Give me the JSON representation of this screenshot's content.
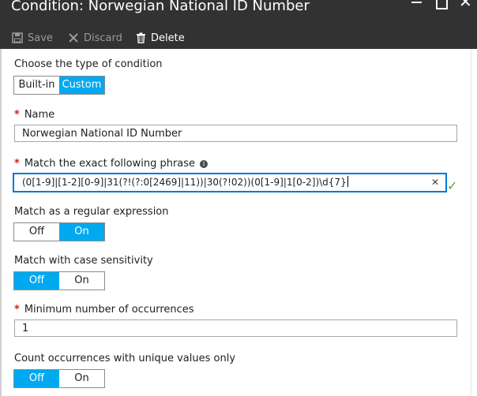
{
  "window": {
    "title": "Condition: Norwegian National ID Number",
    "minimize_glyph": "",
    "maximize_glyph": "",
    "close_glyph": "✕"
  },
  "toolbar": {
    "save_label": "Save",
    "discard_label": "Discard",
    "delete_label": "Delete"
  },
  "condition_type": {
    "label": "Choose the type of condition",
    "options": [
      "Built-in",
      "Custom"
    ],
    "selected": "Custom"
  },
  "name": {
    "required_marker": "*",
    "label": "Name",
    "value": "Norwegian National ID Number"
  },
  "phrase": {
    "required_marker": "*",
    "label": "Match the exact following phrase",
    "info_glyph": "i",
    "value": "(0[1-9]|[1-2][0-9]|31(?!(?:0[2469]|11))|30(?!02))(0[1-9]|1[0-2])\\d{7}",
    "clear_glyph": "✕",
    "valid_glyph": "✓"
  },
  "regex": {
    "label": "Match as a regular expression",
    "options": [
      "Off",
      "On"
    ],
    "selected": "On"
  },
  "case_sensitivity": {
    "label": "Match with case sensitivity",
    "options": [
      "Off",
      "On"
    ],
    "selected": "Off"
  },
  "min_occurrences": {
    "required_marker": "*",
    "label": "Minimum number of occurrences",
    "value": "1"
  },
  "unique_values": {
    "label": "Count occurrences with unique values only",
    "options": [
      "Off",
      "On"
    ],
    "selected": "Off"
  },
  "colors": {
    "title_bar": "#323232",
    "toggle_selected": "#00a9f0",
    "required": "#d21f1f",
    "focus_border": "#0078d7",
    "valid": "#5ea52b"
  }
}
